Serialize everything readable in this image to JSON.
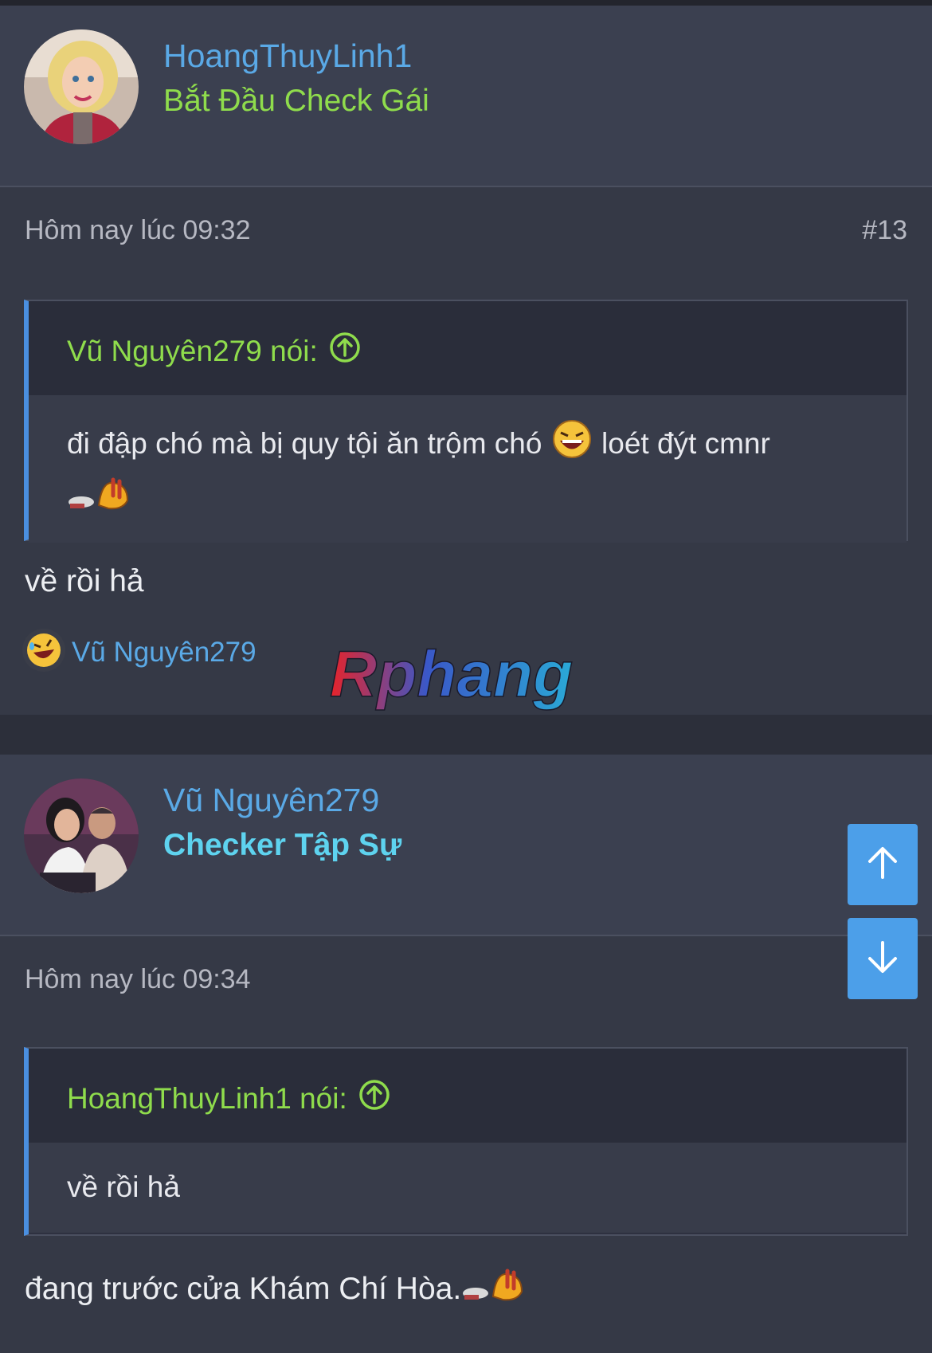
{
  "posts": [
    {
      "username": "HoangThuyLinh1",
      "user_title": "Bắt Đầu Check Gái",
      "timestamp": "Hôm nay lúc 09:32",
      "post_number": "#13",
      "quote": {
        "author": "Vũ Nguyên279 nói:",
        "text_part1": "đi đập chó mà bị quy tội ăn trộm chó",
        "text_part2": "loét đýt cmnr"
      },
      "message": "về rồi hả",
      "reaction_user": "Vũ Nguyên279"
    },
    {
      "username": "Vũ Nguyên279",
      "user_title": "Checker Tập Sự",
      "timestamp": "Hôm nay lúc 09:34",
      "quote": {
        "author": "HoangThuyLinh1 nói:",
        "text": "về rồi hả"
      },
      "message": "đang trước cửa Khám Chí Hòa."
    }
  ],
  "watermark": "Rphang",
  "icons": {
    "quote_jump": "arrow-up-circle-icon",
    "laugh": "laughing-emoji-icon",
    "running": "running-away-emoji-icon",
    "reaction": "rolling-laugh-emoji-icon",
    "scroll_up": "arrow-up-icon",
    "scroll_down": "arrow-down-icon"
  },
  "colors": {
    "username": "#5aa9e6",
    "title_green": "#8fdc4c",
    "title_cyan": "#5ed3ef",
    "quote_bar": "#4a8fe0",
    "scroll_button": "#4c9fe9"
  }
}
